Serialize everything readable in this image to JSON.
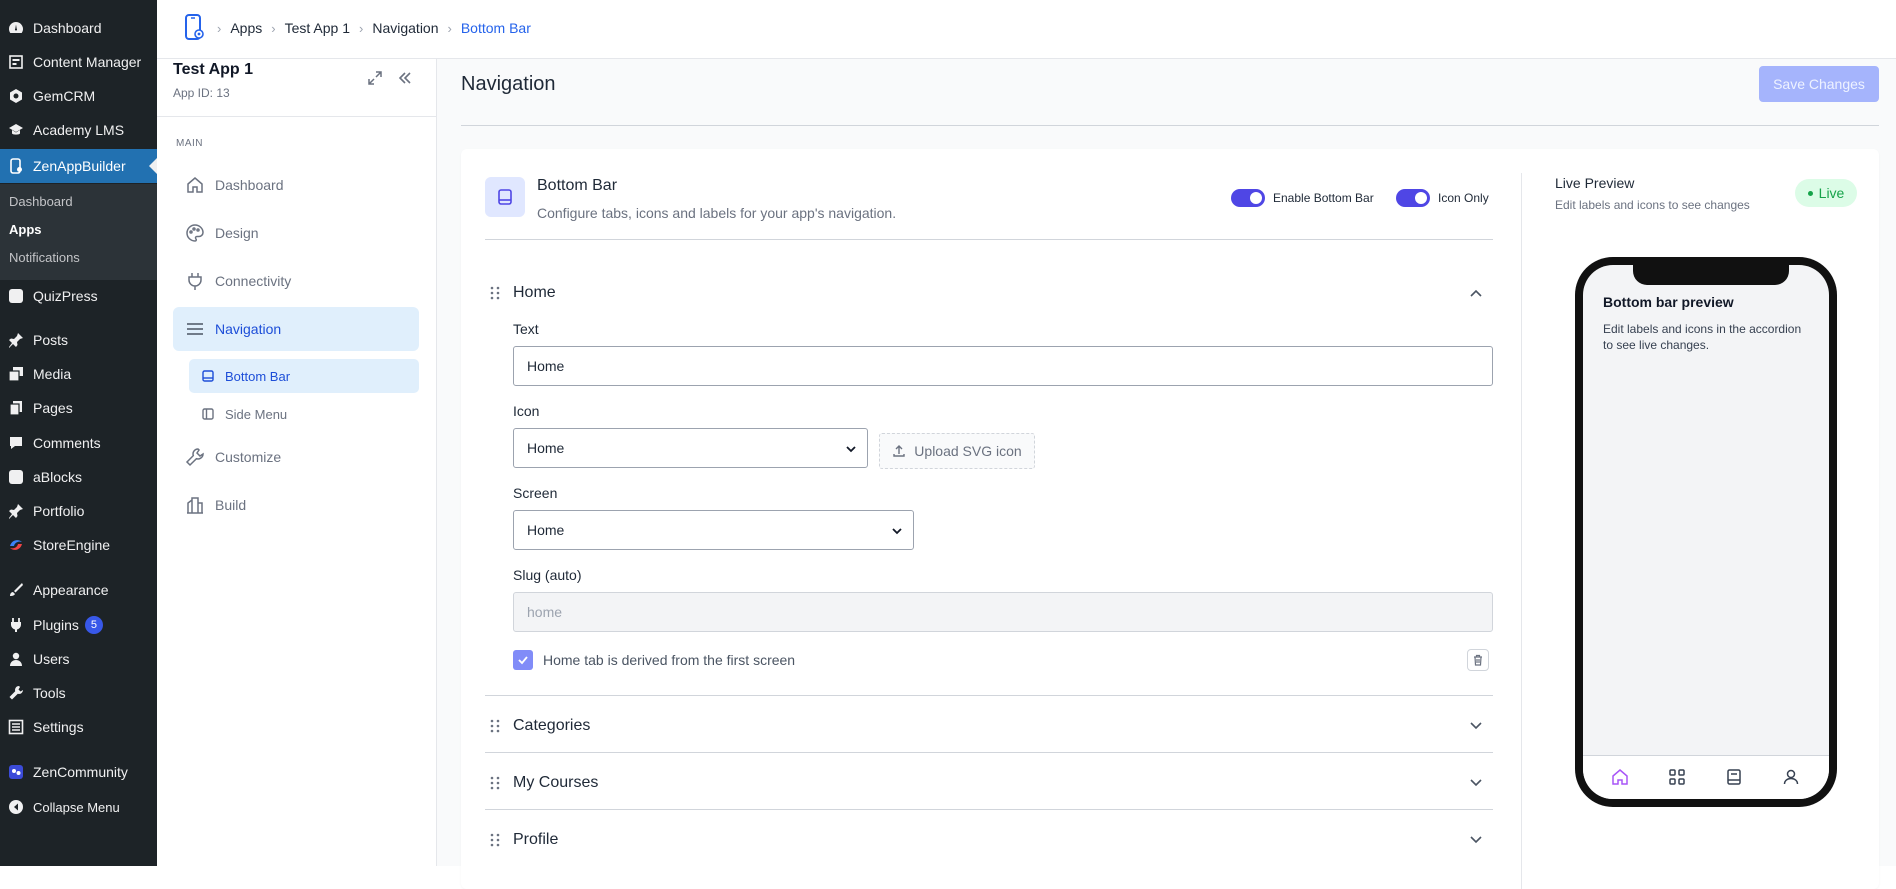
{
  "wp_menu": [
    {
      "label": "Dashboard",
      "icon": "dashboard-icon"
    },
    {
      "label": "Content Manager",
      "icon": "content-manager-icon"
    },
    {
      "label": "GemCRM",
      "icon": "gemcrm-icon"
    },
    {
      "label": "Academy LMS",
      "icon": "academy-lms-icon"
    },
    {
      "label": "ZenAppBuilder",
      "icon": "zenappbuilder-icon"
    },
    {
      "label": "QuizPress",
      "icon": "quizpress-icon"
    },
    {
      "label": "Posts",
      "icon": "posts-icon"
    },
    {
      "label": "Media",
      "icon": "media-icon"
    },
    {
      "label": "Pages",
      "icon": "pages-icon"
    },
    {
      "label": "Comments",
      "icon": "comments-icon"
    },
    {
      "label": "aBlocks",
      "icon": "ablocks-icon"
    },
    {
      "label": "Portfolio",
      "icon": "portfolio-icon"
    },
    {
      "label": "StoreEngine",
      "icon": "storeengine-icon"
    },
    {
      "label": "Appearance",
      "icon": "appearance-icon"
    },
    {
      "label": "Plugins",
      "icon": "plugins-icon",
      "badge": "5"
    },
    {
      "label": "Users",
      "icon": "users-icon"
    },
    {
      "label": "Tools",
      "icon": "tools-icon"
    },
    {
      "label": "Settings",
      "icon": "settings-icon"
    },
    {
      "label": "ZenCommunity",
      "icon": "zencommunity-icon"
    },
    {
      "label": "Collapse Menu",
      "icon": "collapse-icon"
    }
  ],
  "wp_submenu": [
    "Dashboard",
    "Apps",
    "Notifications"
  ],
  "breadcrumb": [
    "Apps",
    "Test App 1",
    "Navigation",
    "Bottom Bar"
  ],
  "app": {
    "title": "Test App 1",
    "id_label": "App ID: 13",
    "section": "MAIN"
  },
  "nav_items": [
    "Dashboard",
    "Design",
    "Connectivity",
    "Navigation"
  ],
  "sub_items": [
    "Bottom Bar",
    "Side Menu"
  ],
  "nav_items2": [
    "Customize",
    "Build"
  ],
  "main": {
    "title": "Navigation",
    "save_label": "Save Changes"
  },
  "card": {
    "title": "Bottom Bar",
    "description": "Configure tabs, icons and labels for your app's navigation.",
    "toggle_enable": "Enable Bottom Bar",
    "toggle_icon_only": "Icon Only"
  },
  "home_tab": {
    "title": "Home",
    "text_label": "Text",
    "text_value": "Home",
    "icon_label": "Icon",
    "icon_value": "Home",
    "upload_label": "Upload SVG icon",
    "screen_label": "Screen",
    "screen_value": "Home",
    "slug_label": "Slug (auto)",
    "slug_placeholder": "home",
    "checkbox_label": "Home tab is derived from the first screen",
    "checked": true
  },
  "other_tabs": [
    "Categories",
    "My Courses",
    "Profile"
  ],
  "preview": {
    "title": "Live Preview",
    "description": "Edit labels and icons to see changes",
    "badge": "Live",
    "phone_title": "Bottom bar preview",
    "phone_text": "Edit labels and icons in the accordion to see live changes.",
    "tab_icons": [
      "home-icon",
      "grid-icon",
      "book-icon",
      "user-icon"
    ]
  },
  "colors": {
    "accent": "#4f46e5",
    "wp_active": "#2271b1",
    "live": "#16a34a",
    "breadcrumb_current": "#2563eb"
  }
}
